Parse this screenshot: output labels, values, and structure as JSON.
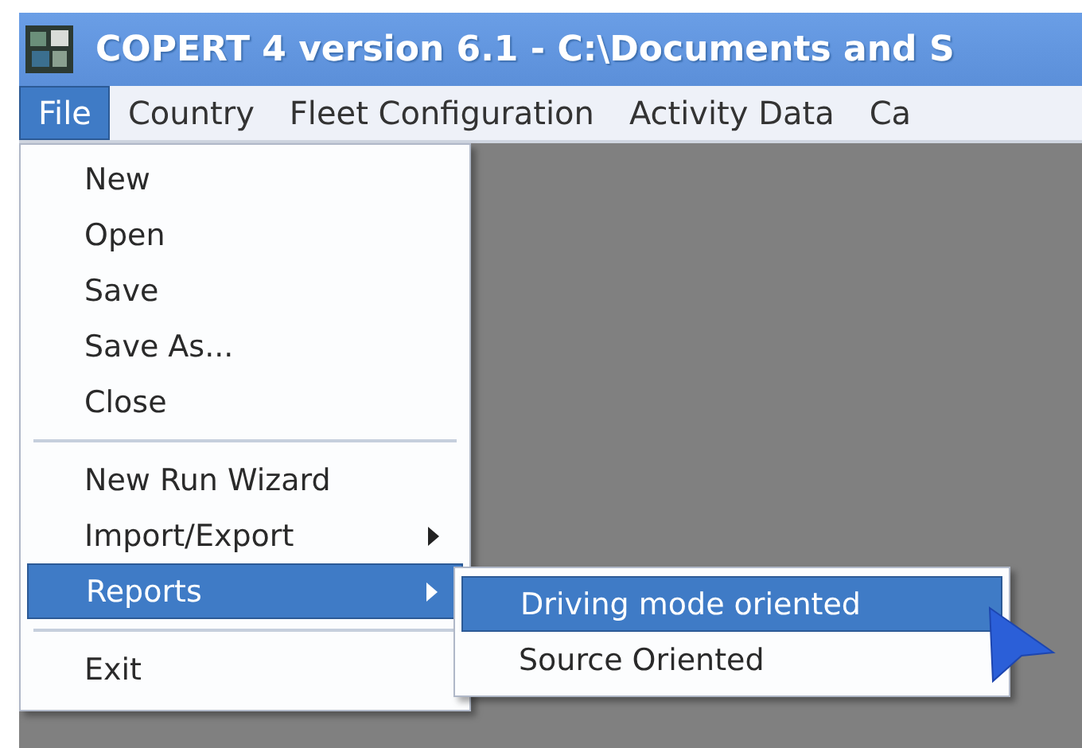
{
  "window": {
    "title": "COPERT 4 version 6.1 - C:\\Documents and S"
  },
  "menubar": [
    {
      "label": "File",
      "selected": true
    },
    {
      "label": "Country",
      "selected": false
    },
    {
      "label": "Fleet Configuration",
      "selected": false
    },
    {
      "label": "Activity Data",
      "selected": false
    },
    {
      "label": "Ca",
      "selected": false
    }
  ],
  "file_menu": [
    {
      "kind": "item",
      "label": "New",
      "submenu": false,
      "selected": false
    },
    {
      "kind": "item",
      "label": "Open",
      "submenu": false,
      "selected": false
    },
    {
      "kind": "item",
      "label": "Save",
      "submenu": false,
      "selected": false
    },
    {
      "kind": "item",
      "label": "Save As...",
      "submenu": false,
      "selected": false
    },
    {
      "kind": "item",
      "label": "Close",
      "submenu": false,
      "selected": false
    },
    {
      "kind": "separator"
    },
    {
      "kind": "item",
      "label": "New Run Wizard",
      "submenu": false,
      "selected": false
    },
    {
      "kind": "item",
      "label": "Import/Export",
      "submenu": true,
      "selected": false
    },
    {
      "kind": "item",
      "label": "Reports",
      "submenu": true,
      "selected": true
    },
    {
      "kind": "separator"
    },
    {
      "kind": "item",
      "label": "Exit",
      "submenu": false,
      "selected": false
    }
  ],
  "reports_submenu": [
    {
      "label": "Driving mode oriented",
      "selected": true
    },
    {
      "label": "Source Oriented",
      "selected": false
    }
  ]
}
